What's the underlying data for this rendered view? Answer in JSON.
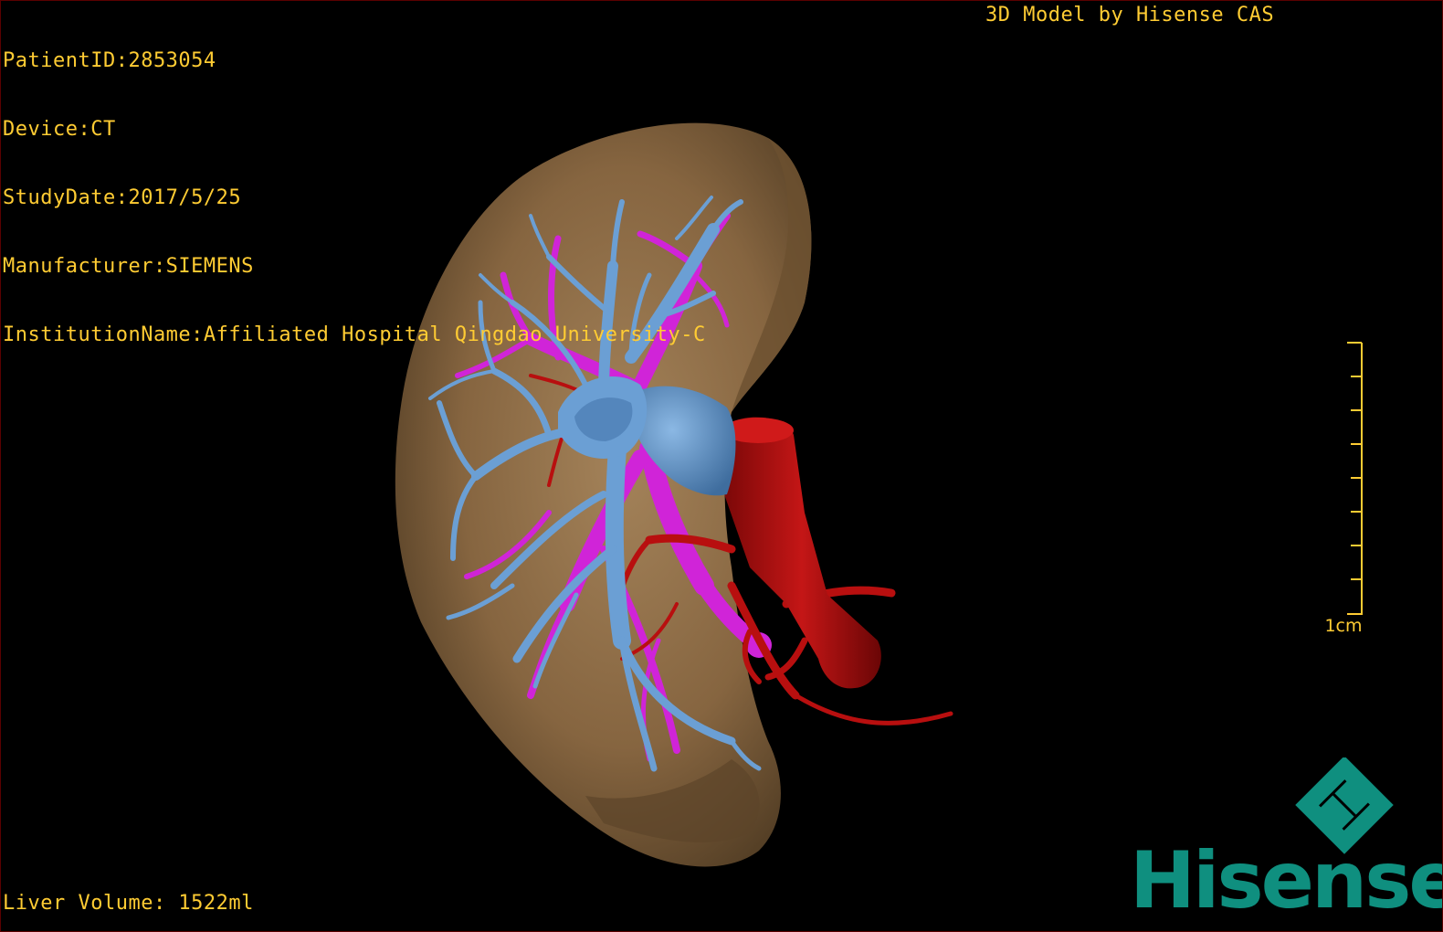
{
  "header": {
    "patient_id": "PatientID:2853054",
    "device": "Device:CT",
    "study_date": "StudyDate:2017/5/25",
    "manufacturer": "Manufacturer:SIEMENS",
    "institution": "InstitutionName:Affiliated Hospital Qingdao University-C"
  },
  "credit": "3D Model by Hisense CAS",
  "footer": {
    "liver_volume": "Liver Volume: 1522ml"
  },
  "scale": {
    "label": "1cm"
  },
  "brand": {
    "name": "Hisense",
    "logo_icon": "hisense-h-diamond-icon"
  },
  "colors": {
    "overlay_text": "#ffcc33",
    "liver": "#8c6c45",
    "portal_vein": "#6b9fd4",
    "hepatic_vein": "#d024d8",
    "artery": "#b80f0f",
    "brand": "#0f8f7f",
    "background": "#000000"
  }
}
